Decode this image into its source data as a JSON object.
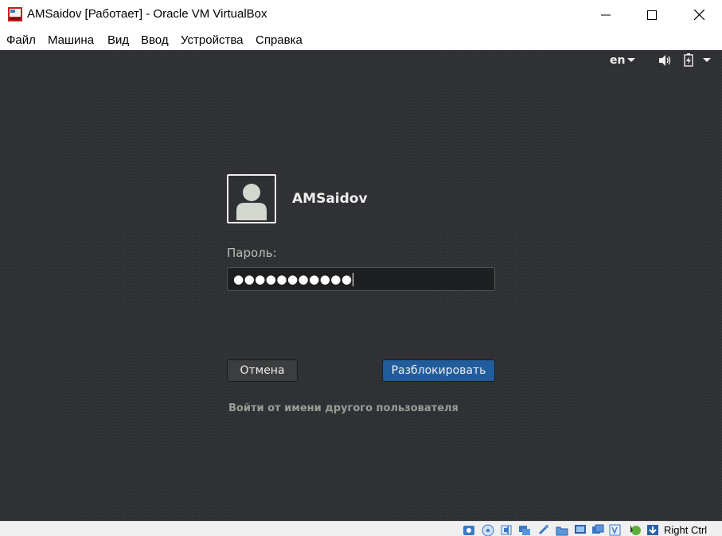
{
  "window": {
    "title": "AMSaidov [Работает] - Oracle VM VirtualBox",
    "icon": "virtualbox-icon"
  },
  "menu": [
    "Файл",
    "Машина",
    "Вид",
    "Ввод",
    "Устройства",
    "Справка"
  ],
  "gnome_topbar": {
    "language": "en",
    "icons": [
      "volume-icon",
      "battery-icon",
      "system-menu-arrow-icon"
    ]
  },
  "lock_screen": {
    "username": "AMSaidov",
    "password_label": "Пароль:",
    "password_value": "●●●●●●●●●●●",
    "cancel_label": "Отмена",
    "unlock_label": "Разблокировать",
    "other_user_label": "Войти от имени другого пользователя"
  },
  "status_bar": {
    "icons": [
      "hard-disk-icon",
      "optical-drive-icon",
      "audio-icon",
      "network-icon",
      "usb-icon",
      "shared-folders-icon",
      "display-icon",
      "video-capture-icon",
      "virtualization-icon",
      "mouse-integration-icon",
      "keyboard-icon"
    ],
    "host_key": "Right Ctrl"
  },
  "colors": {
    "vm_background": "#2e3033",
    "unlock_button": "#215d9c",
    "text_light": "#eeeeec"
  }
}
